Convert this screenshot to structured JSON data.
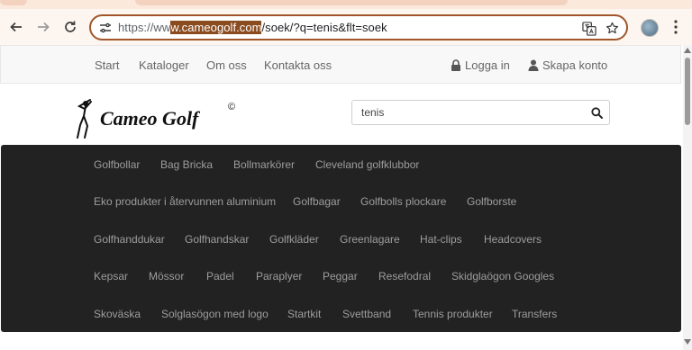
{
  "browser": {
    "url_before": "https://ww",
    "url_highlight": "w.cameogolf.com",
    "url_after": "/soek/?q=tenis&flt=soek"
  },
  "topnav": {
    "links": [
      "Start",
      "Kataloger",
      "Om oss",
      "Kontakta oss"
    ],
    "login": "Logga in",
    "signup": "Skapa konto"
  },
  "logo": {
    "text": "Cameo Golf",
    "copyright": "©"
  },
  "search": {
    "value": "tenis"
  },
  "categories": [
    [
      "Golfbollar",
      "Bag Bricka",
      "Bollmarkörer",
      "Cleveland golfklubbor"
    ],
    [
      "Eko produkter i återvunnen aluminium",
      "Golfbagar",
      "Golfbolls plockare",
      "Golfborste"
    ],
    [
      "Golfhanddukar",
      "Golfhandskar",
      "Golfkläder",
      "Greenlagare",
      "Hat-clips",
      "Headcovers"
    ],
    [
      "Kepsar",
      "Mössor",
      "Padel",
      "Paraplyer",
      "Peggar",
      "Resefodral",
      "Skidglaögon Googles"
    ],
    [
      "Skoväska",
      "Solglasögon med logo",
      "Startkit",
      "Svettband",
      "Tennis produkter",
      "Transfers"
    ]
  ],
  "colors": {
    "omnibox_border": "#a0562a",
    "url_highlight_bg": "#8a4b1f",
    "category_panel_bg": "#222222",
    "category_text": "#9d9d9d"
  }
}
